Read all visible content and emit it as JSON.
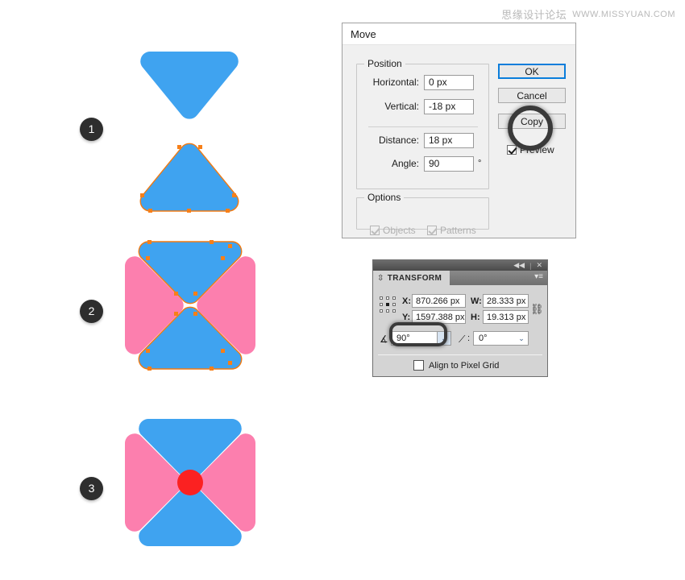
{
  "watermark": {
    "cn": "思缘设计论坛",
    "en": "WWW.MISSYUAN.COM"
  },
  "steps": [
    {
      "label": "1"
    },
    {
      "label": "2"
    },
    {
      "label": "3"
    }
  ],
  "colors": {
    "blue": "#3fa3f0",
    "pink": "#fc7fae",
    "red": "#fb2121",
    "anchor": "#f77f18",
    "stroke": "#f07a12"
  },
  "move_dialog": {
    "title": "Move",
    "position_group": {
      "legend": "Position",
      "fields": [
        {
          "label": "Horizontal:",
          "value": "0 px",
          "highlighted": false
        },
        {
          "label": "Vertical:",
          "value": "-18 px",
          "highlighted": true
        },
        {
          "label": "Distance:",
          "value": "18 px",
          "highlighted": false
        },
        {
          "label": "Angle:",
          "value": "90",
          "unit": "°",
          "highlighted": false
        }
      ]
    },
    "options_group": {
      "legend": "Options",
      "checkboxes": [
        {
          "label": "Objects",
          "checked": true,
          "disabled": true
        },
        {
          "label": "Patterns",
          "checked": true,
          "disabled": true
        }
      ]
    },
    "buttons": [
      {
        "label": "OK",
        "primary": true
      },
      {
        "label": "Cancel",
        "primary": false
      },
      {
        "label": "Copy",
        "primary": false,
        "highlighted": true
      }
    ],
    "preview": {
      "label": "Preview",
      "checked": true
    }
  },
  "transform_panel": {
    "title": "TRANSFORM",
    "icons": {
      "collapse": "◀◀",
      "close": "✕",
      "menu": "▾≡",
      "link": "chain-link-icon",
      "reference_point": "center"
    },
    "fields": [
      {
        "label": "X:",
        "value": "870.266 px"
      },
      {
        "label": "Y:",
        "value": "1597.388 px"
      },
      {
        "label": "W:",
        "value": "28.333 px"
      },
      {
        "label": "H:",
        "value": "19.313 px"
      }
    ],
    "rotate": {
      "value": "90°",
      "highlighted": true
    },
    "shear": {
      "value": "0°",
      "highlighted": false
    },
    "align_pixel_grid": {
      "label": "Align to Pixel Grid",
      "checked": false
    }
  }
}
